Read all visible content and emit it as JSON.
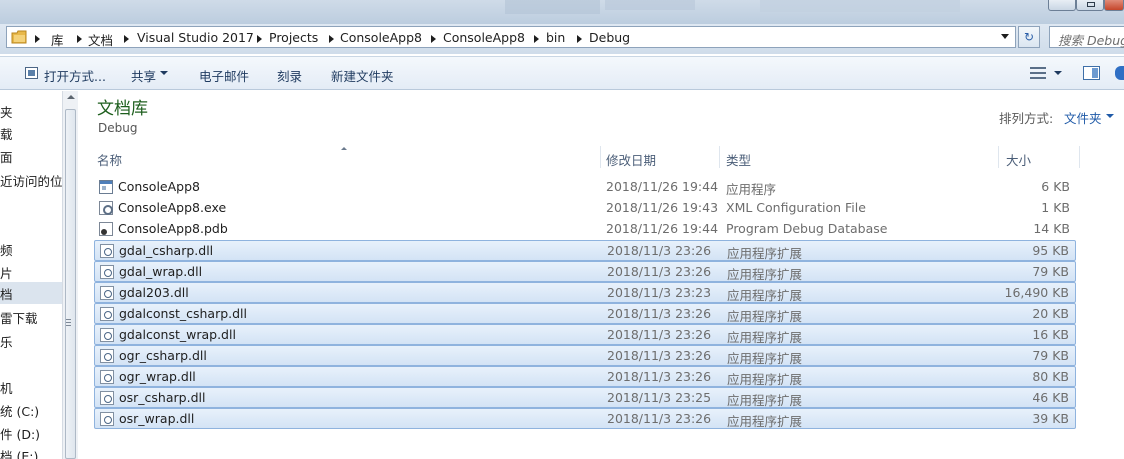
{
  "address": {
    "crumbs": [
      "库",
      "文档",
      "Visual Studio 2017",
      "Projects",
      "ConsoleApp8",
      "ConsoleApp8",
      "bin",
      "Debug"
    ],
    "search_placeholder": "搜索 Debug"
  },
  "toolbar": {
    "open_with": "打开方式...",
    "share": "共享",
    "email": "电子邮件",
    "burn": "刻录",
    "new_folder": "新建文件夹"
  },
  "nav": {
    "items": [
      "夹",
      "载",
      "面",
      "近访问的位",
      "频",
      "片",
      "档",
      "雷下载",
      "乐",
      "机",
      "统 (C:)",
      "件 (D:)",
      "档 (E:)"
    ],
    "selected_index": 6
  },
  "library": {
    "title": "文档库",
    "subtitle": "Debug",
    "arrange_label": "排列方式:",
    "arrange_value": "文件夹"
  },
  "columns": {
    "name": "名称",
    "date": "修改日期",
    "type": "类型",
    "size": "大小"
  },
  "files": [
    {
      "name": "ConsoleApp8",
      "date": "2018/11/26 19:44",
      "type": "应用程序",
      "size": "6 KB",
      "icon": "app-icon",
      "selected": false
    },
    {
      "name": "ConsoleApp8.exe",
      "date": "2018/11/26 19:43",
      "type": "XML Configuration File",
      "size": "1 KB",
      "icon": "config-file-icon",
      "selected": false
    },
    {
      "name": "ConsoleApp8.pdb",
      "date": "2018/11/26 19:44",
      "type": "Program Debug Database",
      "size": "14 KB",
      "icon": "pdb-file-icon",
      "selected": false
    },
    {
      "name": "gdal_csharp.dll",
      "date": "2018/11/3 23:26",
      "type": "应用程序扩展",
      "size": "95 KB",
      "icon": "dll-file-icon",
      "selected": true
    },
    {
      "name": "gdal_wrap.dll",
      "date": "2018/11/3 23:26",
      "type": "应用程序扩展",
      "size": "79 KB",
      "icon": "dll-file-icon",
      "selected": true
    },
    {
      "name": "gdal203.dll",
      "date": "2018/11/3 23:23",
      "type": "应用程序扩展",
      "size": "16,490 KB",
      "icon": "dll-file-icon",
      "selected": true
    },
    {
      "name": "gdalconst_csharp.dll",
      "date": "2018/11/3 23:26",
      "type": "应用程序扩展",
      "size": "20 KB",
      "icon": "dll-file-icon",
      "selected": true
    },
    {
      "name": "gdalconst_wrap.dll",
      "date": "2018/11/3 23:26",
      "type": "应用程序扩展",
      "size": "16 KB",
      "icon": "dll-file-icon",
      "selected": true
    },
    {
      "name": "ogr_csharp.dll",
      "date": "2018/11/3 23:26",
      "type": "应用程序扩展",
      "size": "79 KB",
      "icon": "dll-file-icon",
      "selected": true
    },
    {
      "name": "ogr_wrap.dll",
      "date": "2018/11/3 23:26",
      "type": "应用程序扩展",
      "size": "80 KB",
      "icon": "dll-file-icon",
      "selected": true
    },
    {
      "name": "osr_csharp.dll",
      "date": "2018/11/3 23:25",
      "type": "应用程序扩展",
      "size": "46 KB",
      "icon": "dll-file-icon",
      "selected": true
    },
    {
      "name": "osr_wrap.dll",
      "date": "2018/11/3 23:26",
      "type": "应用程序扩展",
      "size": "39 KB",
      "icon": "dll-file-icon",
      "selected": true
    }
  ],
  "colors": {
    "library_title": "#1e5f1e",
    "selection_border": "#8fb3de",
    "link_blue": "#1f5aa8"
  }
}
